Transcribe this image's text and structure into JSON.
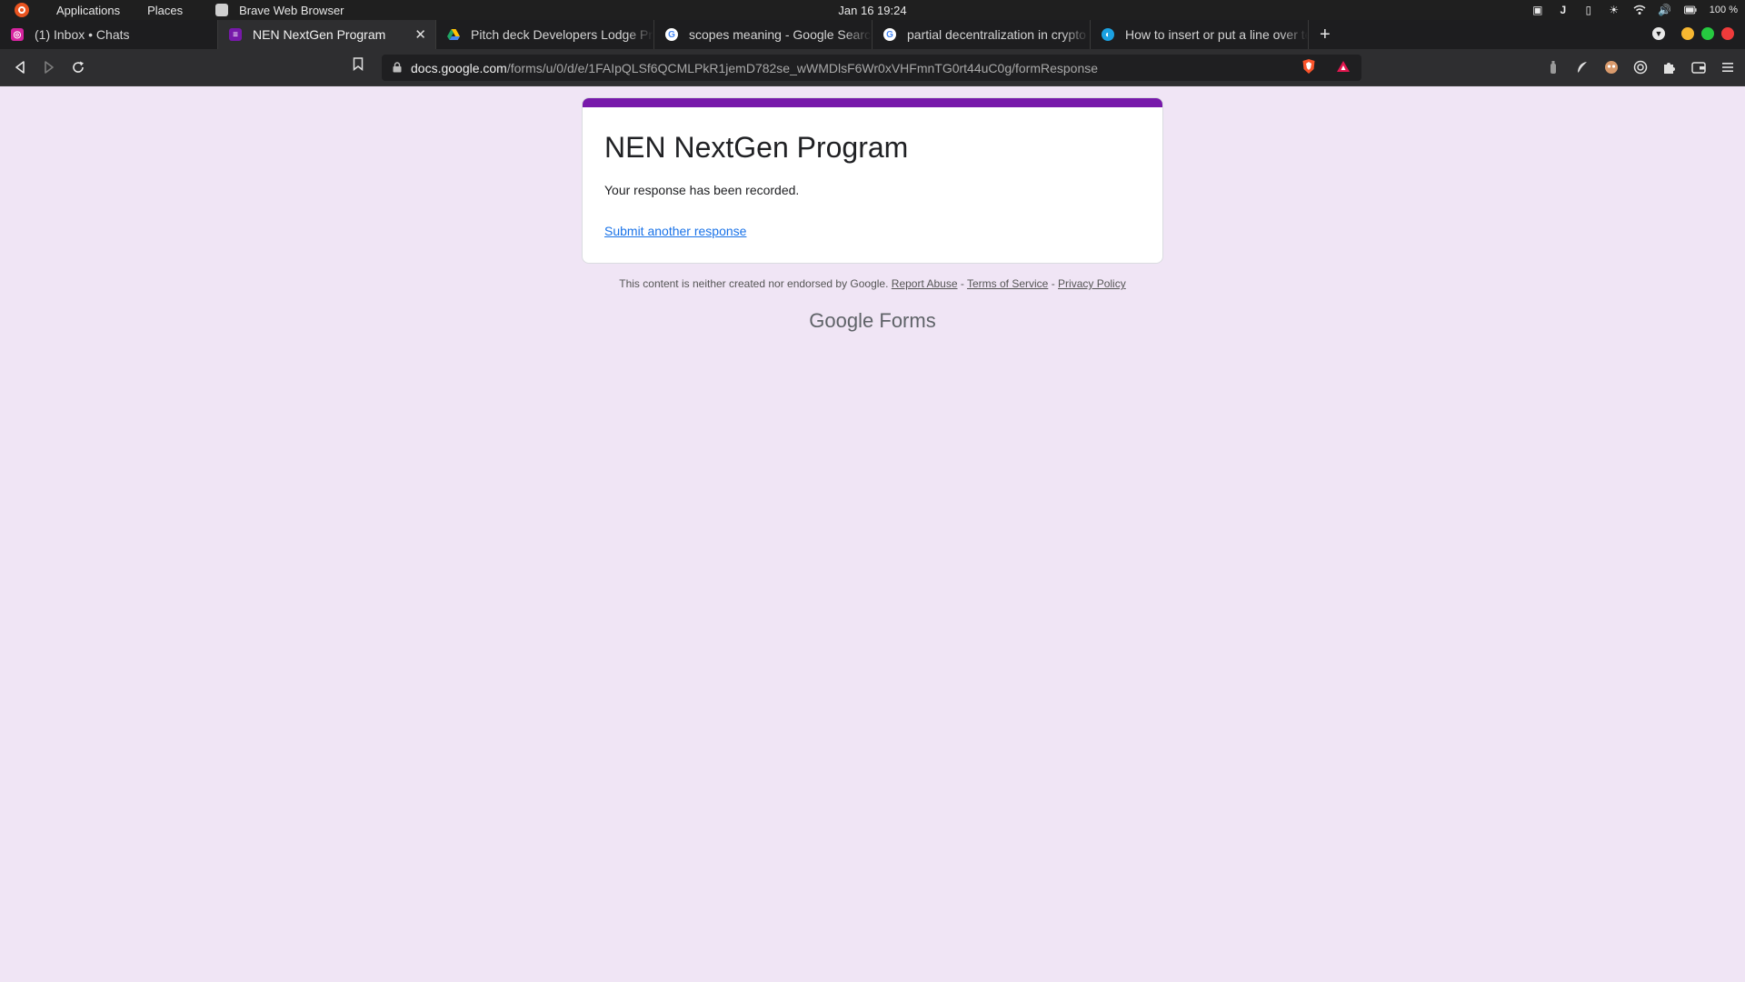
{
  "os": {
    "menu": [
      "Applications",
      "Places"
    ],
    "active_app": "Brave Web Browser",
    "clock": "Jan 16  19:24",
    "battery": "100 %"
  },
  "tabs": [
    {
      "title": "(1) Inbox • Chats",
      "icon": "instagram-icon",
      "color": "#d6249f"
    },
    {
      "title": "NEN NextGen Program",
      "icon": "google-forms-icon",
      "color": "#7719aa",
      "active": true
    },
    {
      "title": "Pitch deck Developers Lodge Pr",
      "icon": "google-drive-icon",
      "color": "#1fa463"
    },
    {
      "title": "scopes meaning - Google Searc",
      "icon": "google-icon",
      "color": "#4285f4"
    },
    {
      "title": "partial decentralization in crypto",
      "icon": "google-icon",
      "color": "#4285f4"
    },
    {
      "title": "How to insert or put a line over te",
      "icon": "site-icon",
      "color": "#1ba1e2"
    }
  ],
  "url": {
    "host": "docs.google.com",
    "path": "/forms/u/0/d/e/1FAIpQLSf6QCMLPkR1jemD782se_wWMDlsF6Wr0xVHFmnTG0rt44uC0g/formResponse"
  },
  "form": {
    "title": "NEN NextGen Program",
    "message": "Your response has been recorded.",
    "submit_another": "Submit another response",
    "accent": "#7719aa"
  },
  "footer": {
    "note": "This content is neither created nor endorsed by Google.",
    "report_abuse": "Report Abuse",
    "terms": "Terms of Service",
    "privacy": "Privacy Policy",
    "sep": "-",
    "brand_google": "Google",
    "brand_forms": "Forms"
  }
}
